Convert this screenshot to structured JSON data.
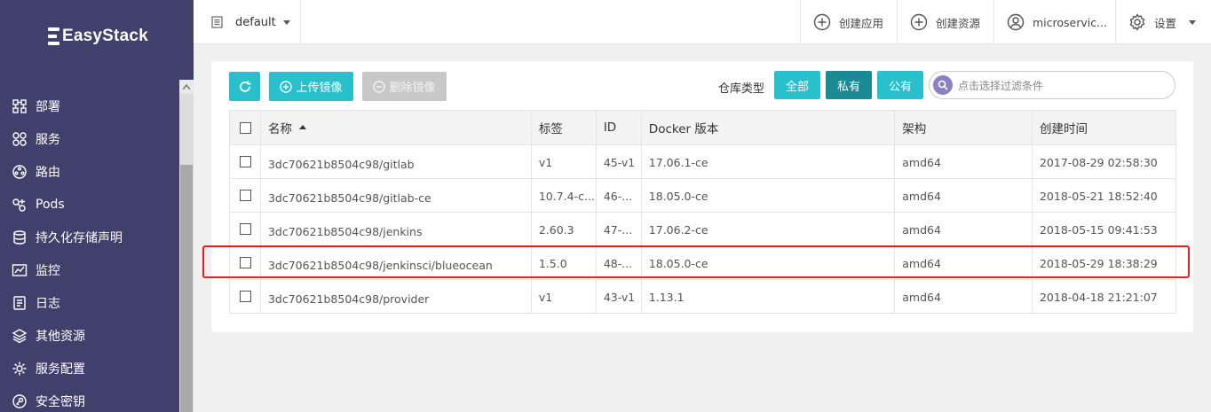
{
  "brand": {
    "name": "EasyStack"
  },
  "sidebar": {
    "items": [
      {
        "label": "部署",
        "icon": "deployment-icon"
      },
      {
        "label": "服务",
        "icon": "service-icon"
      },
      {
        "label": "路由",
        "icon": "route-icon"
      },
      {
        "label": "Pods",
        "icon": "pods-icon"
      },
      {
        "label": "持久化存储声明",
        "icon": "storage-icon"
      },
      {
        "label": "监控",
        "icon": "monitor-icon"
      },
      {
        "label": "日志",
        "icon": "log-icon"
      },
      {
        "label": "其他资源",
        "icon": "layers-icon"
      },
      {
        "label": "服务配置",
        "icon": "config-icon"
      },
      {
        "label": "安全密钥",
        "icon": "key-icon"
      }
    ]
  },
  "topbar": {
    "namespace": "default",
    "create_app": "创建应用",
    "create_resource": "创建资源",
    "user": "microservic...",
    "settings": "设置"
  },
  "toolbar": {
    "upload": "上传镜像",
    "delete": "删除镜像",
    "repo_type_label": "仓库类型",
    "filters": {
      "all": "全部",
      "private": "私有",
      "public": "公有"
    },
    "search_placeholder": "点击选择过滤条件"
  },
  "table": {
    "columns": {
      "name": "名称",
      "tag": "标签",
      "id": "ID",
      "docker": "Docker 版本",
      "arch": "架构",
      "created": "创建时间"
    },
    "rows": [
      {
        "name": "3dc70621b8504c98/gitlab",
        "tag": "v1",
        "id": "45-v1",
        "docker": "17.06.1-ce",
        "arch": "amd64",
        "created": "2017-08-29 02:58:30"
      },
      {
        "name": "3dc70621b8504c98/gitlab-ce",
        "tag": "10.7.4-c...",
        "id": "46-...",
        "docker": "18.05.0-ce",
        "arch": "amd64",
        "created": "2018-05-21 18:52:40"
      },
      {
        "name": "3dc70621b8504c98/jenkins",
        "tag": "2.60.3",
        "id": "47-...",
        "docker": "17.06.2-ce",
        "arch": "amd64",
        "created": "2018-05-15 09:41:53"
      },
      {
        "name": "3dc70621b8504c98/jenkinsci/blueocean",
        "tag": "1.5.0",
        "id": "48-...",
        "docker": "18.05.0-ce",
        "arch": "amd64",
        "created": "2018-05-29 18:38:29"
      },
      {
        "name": "3dc70621b8504c98/provider",
        "tag": "v1",
        "id": "43-v1",
        "docker": "1.13.1",
        "arch": "amd64",
        "created": "2018-04-18 21:21:07"
      }
    ]
  },
  "colors": {
    "sidebar": "#413f6b",
    "accent": "#28c0cc",
    "accent_active": "#1a8a94",
    "highlight": "#e6201f"
  }
}
